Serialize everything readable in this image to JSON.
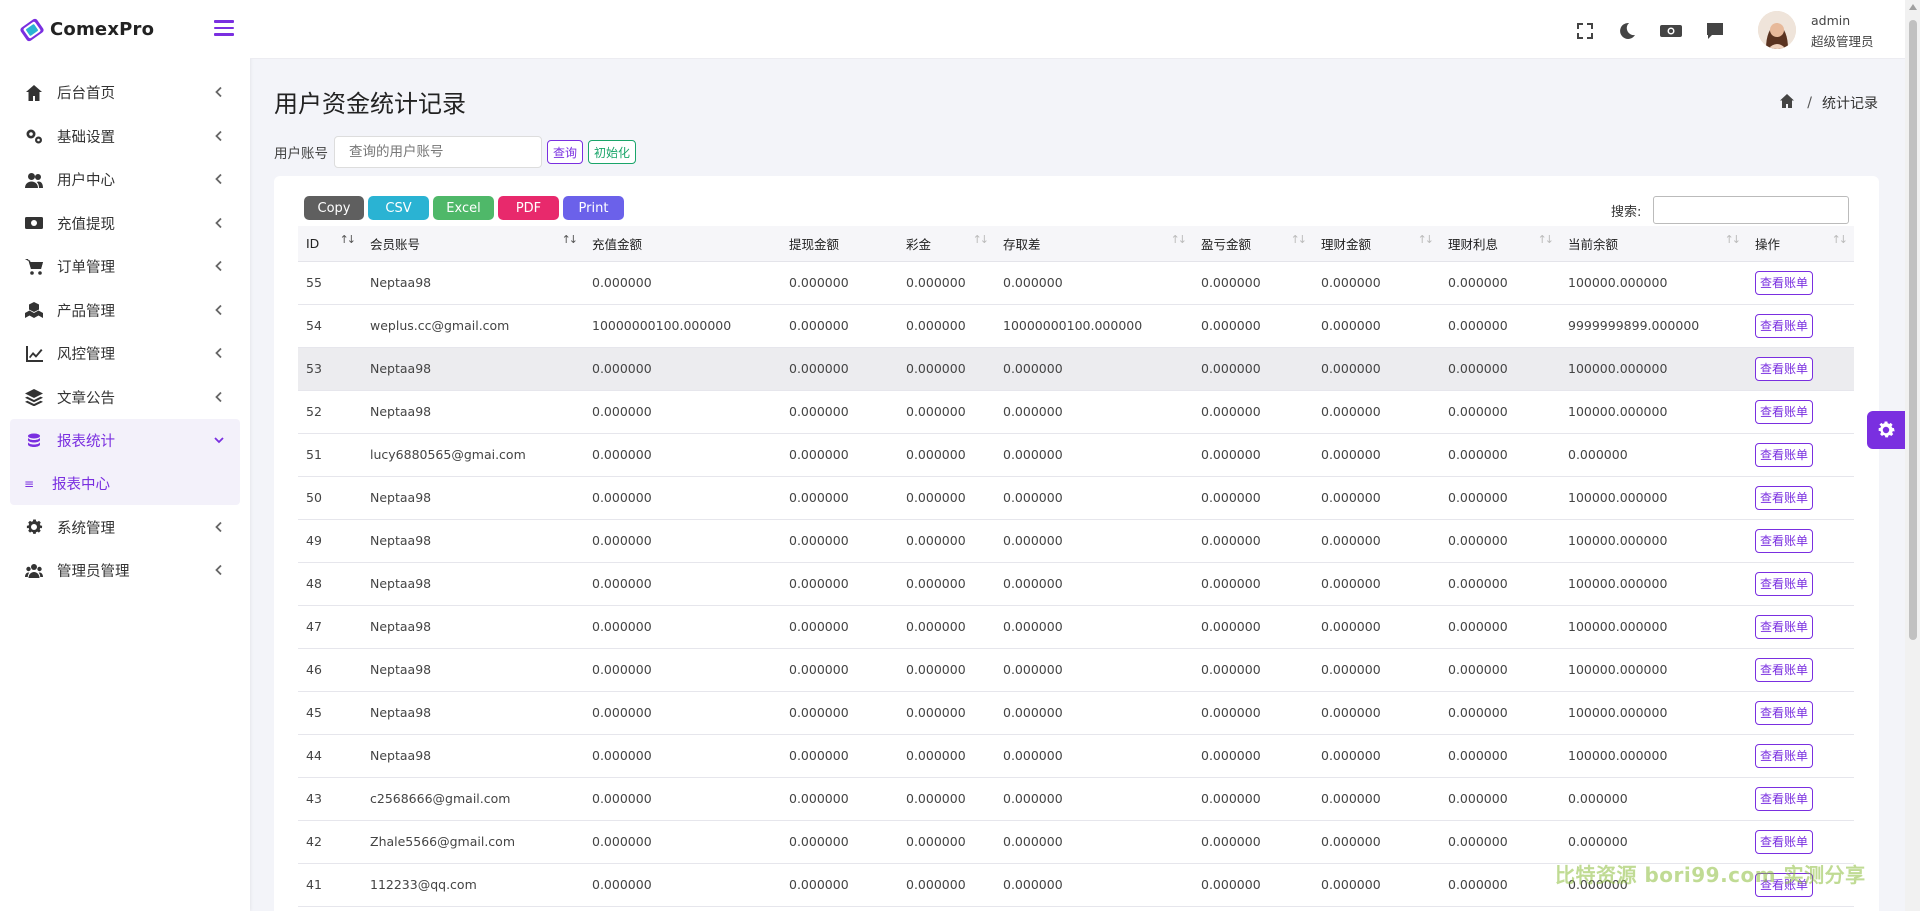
{
  "app": {
    "logo_text": "ComexPro"
  },
  "sidebar": {
    "items": [
      {
        "label": "后台首页",
        "icon": "home-icon"
      },
      {
        "label": "基础设置",
        "icon": "gears-icon"
      },
      {
        "label": "用户中心",
        "icon": "users-icon"
      },
      {
        "label": "充值提现",
        "icon": "money-bill-icon"
      },
      {
        "label": "订单管理",
        "icon": "cart-icon"
      },
      {
        "label": "产品管理",
        "icon": "cubes-icon"
      },
      {
        "label": "风控管理",
        "icon": "chart-line-icon"
      },
      {
        "label": "文章公告",
        "icon": "layers-icon"
      },
      {
        "label": "报表统计",
        "icon": "coins-icon",
        "active": true
      },
      {
        "label": "系统管理",
        "icon": "gear-icon"
      },
      {
        "label": "管理员管理",
        "icon": "user-group-icon"
      }
    ],
    "subitem": {
      "label": "报表中心",
      "icon": "list-icon"
    }
  },
  "header": {
    "user_name": "admin",
    "user_role": "超级管理员",
    "icons": [
      "fullscreen-icon",
      "moon-icon",
      "money-icon",
      "chat-icon"
    ]
  },
  "page": {
    "title": "用户资金统计记录",
    "breadcrumb_current": "统计记录",
    "search_label": "用户账号",
    "search_placeholder": "查询的用户账号",
    "query_btn": "查询",
    "init_btn": "初始化"
  },
  "table": {
    "export_buttons": [
      {
        "label": "Copy",
        "color": "#5f5f5f"
      },
      {
        "label": "CSV",
        "color": "#2ab3d3"
      },
      {
        "label": "Excel",
        "color": "#4fb869"
      },
      {
        "label": "PDF",
        "color": "#e8296c"
      },
      {
        "label": "Print",
        "color": "#6b61ea"
      }
    ],
    "search_label": "搜索:",
    "headers": [
      "ID",
      "会员账号",
      "充值金额",
      "提现金额",
      "彩金",
      "存取差",
      "盈亏金额",
      "理财金额",
      "理财利息",
      "当前余额",
      "操作"
    ],
    "action_label": "查看账单",
    "rows": [
      [
        "55",
        "Neptaa98",
        "0.000000",
        "0.000000",
        "0.000000",
        "0.000000",
        "0.000000",
        "0.000000",
        "0.000000",
        "100000.000000"
      ],
      [
        "54",
        "weplus.cc@gmail.com",
        "10000000100.000000",
        "0.000000",
        "0.000000",
        "10000000100.000000",
        "0.000000",
        "0.000000",
        "0.000000",
        "9999999899.000000"
      ],
      [
        "53",
        "Neptaa98",
        "0.000000",
        "0.000000",
        "0.000000",
        "0.000000",
        "0.000000",
        "0.000000",
        "0.000000",
        "100000.000000"
      ],
      [
        "52",
        "Neptaa98",
        "0.000000",
        "0.000000",
        "0.000000",
        "0.000000",
        "0.000000",
        "0.000000",
        "0.000000",
        "100000.000000"
      ],
      [
        "51",
        "lucy6880565@gmai.com",
        "0.000000",
        "0.000000",
        "0.000000",
        "0.000000",
        "0.000000",
        "0.000000",
        "0.000000",
        "0.000000"
      ],
      [
        "50",
        "Neptaa98",
        "0.000000",
        "0.000000",
        "0.000000",
        "0.000000",
        "0.000000",
        "0.000000",
        "0.000000",
        "100000.000000"
      ],
      [
        "49",
        "Neptaa98",
        "0.000000",
        "0.000000",
        "0.000000",
        "0.000000",
        "0.000000",
        "0.000000",
        "0.000000",
        "100000.000000"
      ],
      [
        "48",
        "Neptaa98",
        "0.000000",
        "0.000000",
        "0.000000",
        "0.000000",
        "0.000000",
        "0.000000",
        "0.000000",
        "100000.000000"
      ],
      [
        "47",
        "Neptaa98",
        "0.000000",
        "0.000000",
        "0.000000",
        "0.000000",
        "0.000000",
        "0.000000",
        "0.000000",
        "100000.000000"
      ],
      [
        "46",
        "Neptaa98",
        "0.000000",
        "0.000000",
        "0.000000",
        "0.000000",
        "0.000000",
        "0.000000",
        "0.000000",
        "100000.000000"
      ],
      [
        "45",
        "Neptaa98",
        "0.000000",
        "0.000000",
        "0.000000",
        "0.000000",
        "0.000000",
        "0.000000",
        "0.000000",
        "100000.000000"
      ],
      [
        "44",
        "Neptaa98",
        "0.000000",
        "0.000000",
        "0.000000",
        "0.000000",
        "0.000000",
        "0.000000",
        "0.000000",
        "100000.000000"
      ],
      [
        "43",
        "c2568666@gmail.com",
        "0.000000",
        "0.000000",
        "0.000000",
        "0.000000",
        "0.000000",
        "0.000000",
        "0.000000",
        "0.000000"
      ],
      [
        "42",
        "Zhale5566@gmail.com",
        "0.000000",
        "0.000000",
        "0.000000",
        "0.000000",
        "0.000000",
        "0.000000",
        "0.000000",
        "0.000000"
      ],
      [
        "41",
        "112233@qq.com",
        "0.000000",
        "0.000000",
        "0.000000",
        "0.000000",
        "0.000000",
        "0.000000",
        "0.000000",
        "0.000000"
      ]
    ]
  },
  "watermark": "比特资源 bori99.com 实测分享"
}
